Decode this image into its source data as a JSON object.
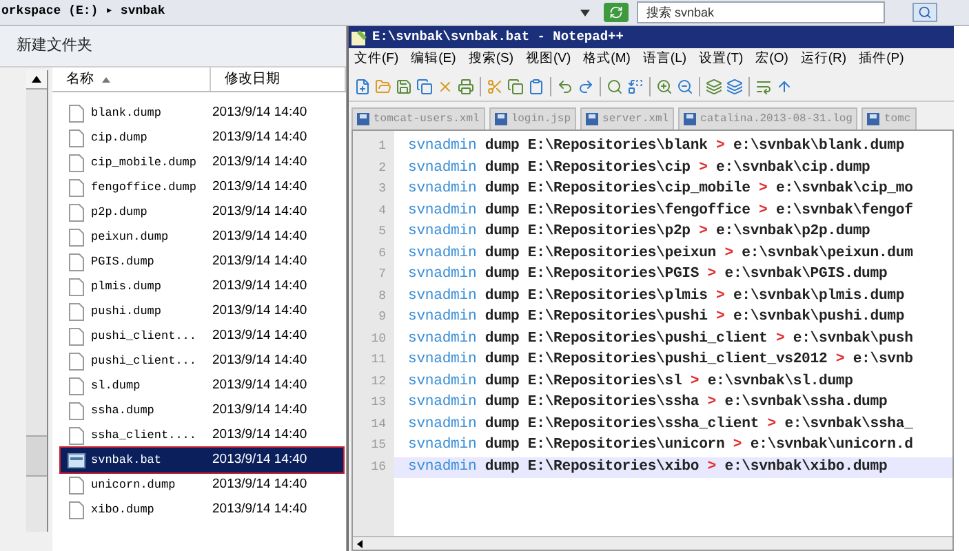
{
  "address_bar": {
    "path": "orkspace (E:) ▸ svnbak",
    "search_placeholder": "搜索 svnbak"
  },
  "explorer": {
    "new_folder": "新建文件夹",
    "columns": [
      {
        "label": "名称",
        "sorted": true
      },
      {
        "label": "修改日期",
        "sorted": false
      }
    ],
    "files": [
      {
        "name": "blank.dump",
        "date": "2013/9/14 14:40",
        "kind": "file",
        "selected": false
      },
      {
        "name": "cip.dump",
        "date": "2013/9/14 14:40",
        "kind": "file",
        "selected": false
      },
      {
        "name": "cip_mobile.dump",
        "date": "2013/9/14 14:40",
        "kind": "file",
        "selected": false
      },
      {
        "name": "fengoffice.dump",
        "date": "2013/9/14 14:40",
        "kind": "file",
        "selected": false
      },
      {
        "name": "p2p.dump",
        "date": "2013/9/14 14:40",
        "kind": "file",
        "selected": false
      },
      {
        "name": "peixun.dump",
        "date": "2013/9/14 14:40",
        "kind": "file",
        "selected": false
      },
      {
        "name": "PGIS.dump",
        "date": "2013/9/14 14:40",
        "kind": "file",
        "selected": false
      },
      {
        "name": "plmis.dump",
        "date": "2013/9/14 14:40",
        "kind": "file",
        "selected": false
      },
      {
        "name": "pushi.dump",
        "date": "2013/9/14 14:40",
        "kind": "file",
        "selected": false
      },
      {
        "name": "pushi_client...",
        "date": "2013/9/14 14:40",
        "kind": "file",
        "selected": false
      },
      {
        "name": "pushi_client...",
        "date": "2013/9/14 14:40",
        "kind": "file",
        "selected": false
      },
      {
        "name": "sl.dump",
        "date": "2013/9/14 14:40",
        "kind": "file",
        "selected": false
      },
      {
        "name": "ssha.dump",
        "date": "2013/9/14 14:40",
        "kind": "file",
        "selected": false
      },
      {
        "name": "ssha_client....",
        "date": "2013/9/14 14:40",
        "kind": "file",
        "selected": false
      },
      {
        "name": "svnbak.bat",
        "date": "2013/9/14 14:40",
        "kind": "script",
        "selected": true
      },
      {
        "name": "unicorn.dump",
        "date": "2013/9/14 14:40",
        "kind": "file",
        "selected": false
      },
      {
        "name": "xibo.dump",
        "date": "2013/9/14 14:40",
        "kind": "file",
        "selected": false
      }
    ]
  },
  "notepad": {
    "title": "E:\\svnbak\\svnbak.bat - Notepad++",
    "menu": [
      "文件(F)",
      "编辑(E)",
      "搜索(S)",
      "视图(V)",
      "格式(M)",
      "语言(L)",
      "设置(T)",
      "宏(O)",
      "运行(R)",
      "插件(P)"
    ],
    "tabs": [
      {
        "label": "tomcat-users.xml",
        "selected": false
      },
      {
        "label": "login.jsp",
        "selected": false
      },
      {
        "label": "server.xml",
        "selected": false
      },
      {
        "label": "catalina.2013-08-31.log",
        "selected": false
      },
      {
        "label": "tomc",
        "selected": false
      }
    ],
    "lines": [
      {
        "number": "1",
        "command": "svnadmin",
        "args": "dump E:\\Repositories\\blank",
        "op": ">",
        "target": "e:\\svnbak\\blank.dump",
        "current": false
      },
      {
        "number": "2",
        "command": "svnadmin",
        "args": "dump E:\\Repositories\\cip",
        "op": ">",
        "target": "e:\\svnbak\\cip.dump",
        "current": false
      },
      {
        "number": "3",
        "command": "svnadmin",
        "args": "dump E:\\Repositories\\cip_mobile",
        "op": ">",
        "target": "e:\\svnbak\\cip_mo",
        "current": false
      },
      {
        "number": "4",
        "command": "svnadmin",
        "args": "dump E:\\Repositories\\fengoffice",
        "op": ">",
        "target": "e:\\svnbak\\fengof",
        "current": false
      },
      {
        "number": "5",
        "command": "svnadmin",
        "args": "dump E:\\Repositories\\p2p",
        "op": ">",
        "target": "e:\\svnbak\\p2p.dump",
        "current": false
      },
      {
        "number": "6",
        "command": "svnadmin",
        "args": "dump E:\\Repositories\\peixun",
        "op": ">",
        "target": "e:\\svnbak\\peixun.dum",
        "current": false
      },
      {
        "number": "7",
        "command": "svnadmin",
        "args": "dump E:\\Repositories\\PGIS",
        "op": ">",
        "target": "e:\\svnbak\\PGIS.dump",
        "current": false
      },
      {
        "number": "8",
        "command": "svnadmin",
        "args": "dump E:\\Repositories\\plmis",
        "op": ">",
        "target": "e:\\svnbak\\plmis.dump",
        "current": false
      },
      {
        "number": "9",
        "command": "svnadmin",
        "args": "dump E:\\Repositories\\pushi",
        "op": ">",
        "target": "e:\\svnbak\\pushi.dump",
        "current": false
      },
      {
        "number": "10",
        "command": "svnadmin",
        "args": "dump E:\\Repositories\\pushi_client",
        "op": ">",
        "target": "e:\\svnbak\\push",
        "current": false
      },
      {
        "number": "11",
        "command": "svnadmin",
        "args": "dump E:\\Repositories\\pushi_client_vs2012",
        "op": ">",
        "target": "e:\\svnb",
        "current": false
      },
      {
        "number": "12",
        "command": "svnadmin",
        "args": "dump E:\\Repositories\\sl",
        "op": ">",
        "target": "e:\\svnbak\\sl.dump",
        "current": false
      },
      {
        "number": "13",
        "command": "svnadmin",
        "args": "dump E:\\Repositories\\ssha",
        "op": ">",
        "target": "e:\\svnbak\\ssha.dump",
        "current": false
      },
      {
        "number": "14",
        "command": "svnadmin",
        "args": "dump E:\\Repositories\\ssha_client",
        "op": ">",
        "target": "e:\\svnbak\\ssha_",
        "current": false
      },
      {
        "number": "15",
        "command": "svnadmin",
        "args": "dump E:\\Repositories\\unicorn",
        "op": ">",
        "target": "e:\\svnbak\\unicorn.d",
        "current": false
      },
      {
        "number": "16",
        "command": "svnadmin",
        "args": "dump E:\\Repositories\\xibo",
        "op": ">",
        "target": "e:\\svnbak\\xibo.dump",
        "current": true
      }
    ]
  }
}
